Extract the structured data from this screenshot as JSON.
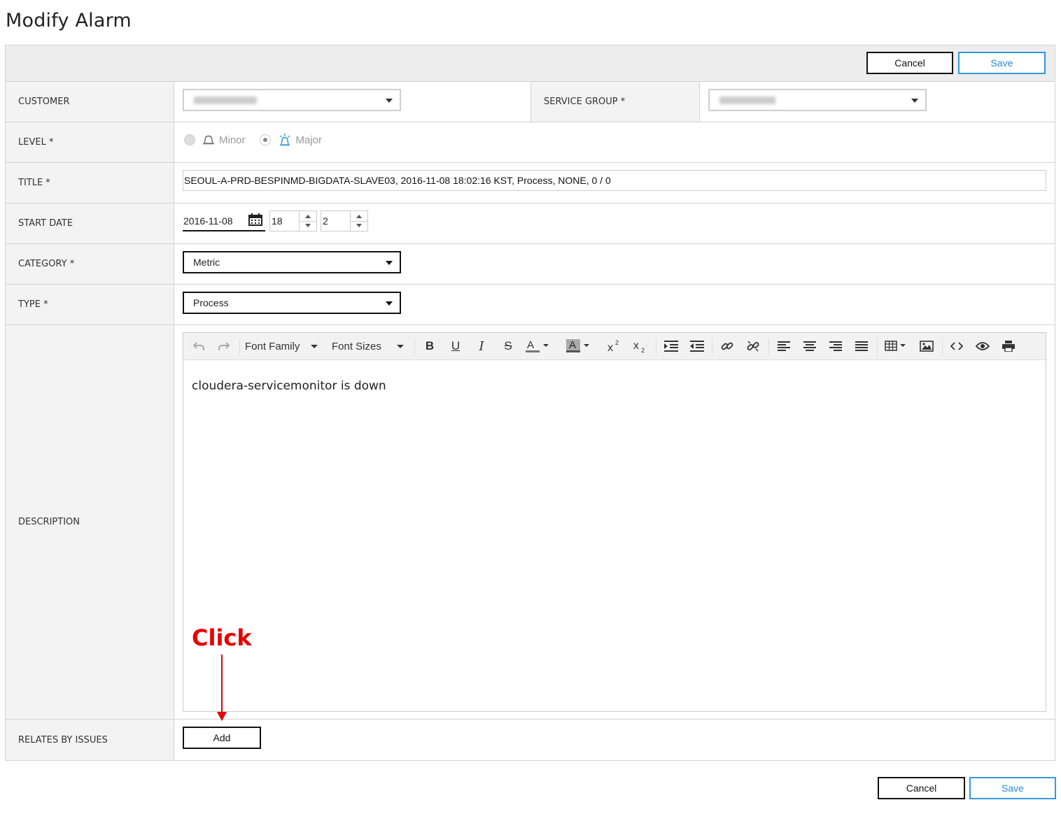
{
  "page": {
    "title": "Modify Alarm"
  },
  "actions": {
    "cancel_label": "Cancel",
    "save_label": "Save"
  },
  "fields": {
    "customer": {
      "label": "CUSTOMER"
    },
    "service_group": {
      "label": "SERVICE GROUP *"
    },
    "level": {
      "label": "LEVEL *",
      "options": [
        "Minor",
        "Major"
      ],
      "selected": "Major"
    },
    "title": {
      "label": "TITLE *",
      "value": "SEOUL-A-PRD-BESPINMD-BIGDATA-SLAVE03, 2016-11-08 18:02:16 KST, Process, NONE, 0 / 0"
    },
    "start_date": {
      "label": "START DATE",
      "date": "2016-11-08",
      "hour": "18",
      "minute": "2"
    },
    "category": {
      "label": "CATEGORY *",
      "value": "Metric"
    },
    "type": {
      "label": "TYPE *",
      "value": "Process"
    },
    "description": {
      "label": "DESCRIPTION",
      "body": "cloudera-servicemonitor is down",
      "toolbar": {
        "font_family": "Font Family",
        "font_sizes": "Font Sizes"
      }
    },
    "relates_by_issues": {
      "label": "RELATES BY ISSUES",
      "add_label": "Add"
    }
  },
  "annotation": {
    "text": "Click",
    "color": "#e60000"
  },
  "colors": {
    "save_accent": "#3399dd",
    "annotation_red": "#e60000",
    "major_icon": "#3aa0e0"
  }
}
